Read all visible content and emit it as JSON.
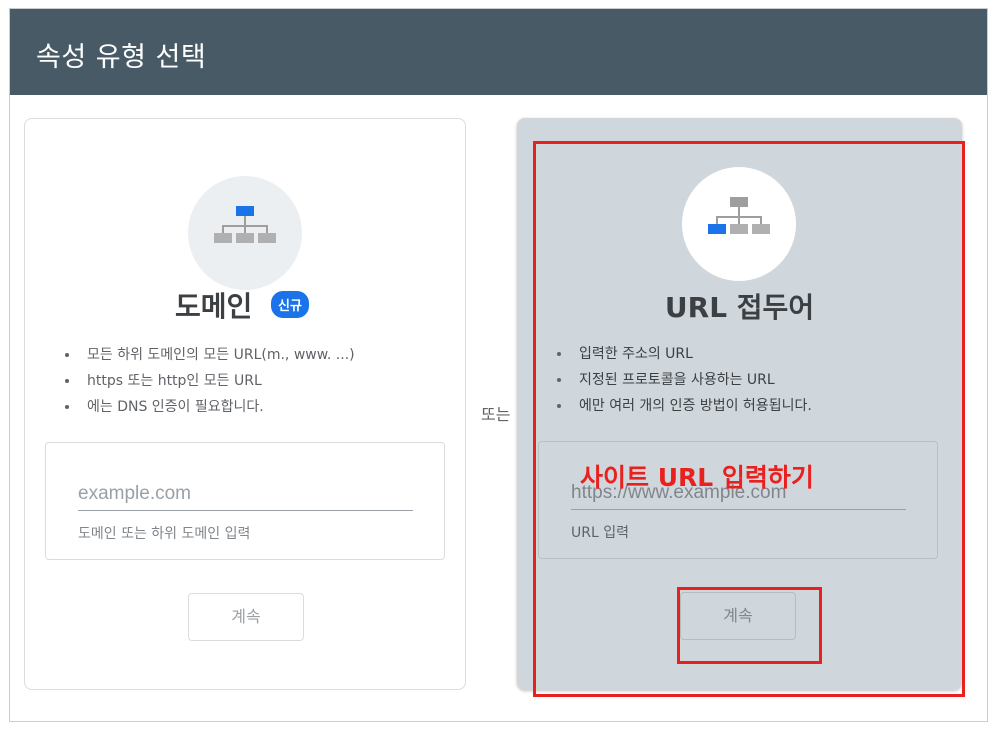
{
  "header": {
    "title": "속성 유형 선택"
  },
  "domain_card": {
    "icon": "sitemap-icon",
    "title": "도메인",
    "badge": "신규",
    "bullets": [
      "모든 하위 도메인의 모든 URL(m., www. ...)",
      "https 또는 http인 모든 URL",
      "에는 DNS 인증이 필요합니다."
    ],
    "input_placeholder": "example.com",
    "input_hint": "도메인 또는 하위 도메인 입력",
    "button_label": "계속"
  },
  "or_label": "또는",
  "url_prefix_card": {
    "icon": "sitemap-icon",
    "title": "URL 접두어",
    "bullets": [
      "입력한 주소의 URL",
      "지정된 프로토콜을 사용하는 URL",
      "에만 여러 개의 인증 방법이 허용됩니다."
    ],
    "input_placeholder": "https://www.example.com",
    "input_hint": "URL 입력",
    "button_label": "계속"
  },
  "annotation": {
    "text": "사이트 URL 입력하기",
    "color": "#e8211f"
  },
  "colors": {
    "header_bg": "#485a65",
    "accent_blue": "#1a73e8",
    "selected_card_bg": "#d0d7dc",
    "highlight": "#e8211f"
  }
}
